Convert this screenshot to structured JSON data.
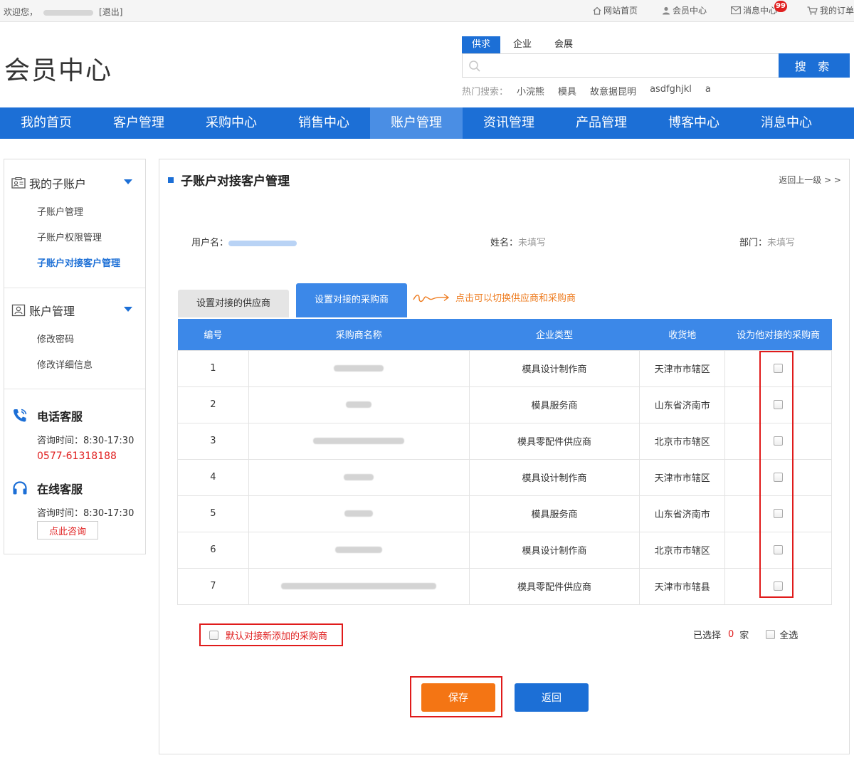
{
  "topbar": {
    "welcome": "欢迎您，",
    "logout": "[退出]",
    "links": [
      {
        "label": "网站首页",
        "icon": "home-icon"
      },
      {
        "label": "会员中心",
        "icon": "user-icon"
      },
      {
        "label": "消息中心",
        "icon": "mail-icon",
        "badge": "99"
      },
      {
        "label": "我的订单",
        "icon": "cart-icon"
      }
    ]
  },
  "header": {
    "logo": "会员中心",
    "search_tabs": [
      "供求",
      "企业",
      "会展"
    ],
    "search_button": "搜 索",
    "hot_label": "热门搜索：",
    "hot_keywords": [
      "小浣熊",
      "模具",
      "故意据昆明",
      "asdfghjkl",
      "a"
    ]
  },
  "nav": [
    "我的首页",
    "客户管理",
    "采购中心",
    "销售中心",
    "账户管理",
    "资讯管理",
    "产品管理",
    "博客中心",
    "消息中心"
  ],
  "sidebar": {
    "section1": {
      "title": "我的子账户",
      "items": [
        "子账户管理",
        "子账户权限管理",
        "子账户对接客户管理"
      ]
    },
    "section2": {
      "title": "账户管理",
      "items": [
        "修改密码",
        "修改详细信息"
      ]
    },
    "phone_service": {
      "title": "电话客服",
      "hours": "咨询时间：8:30-17:30",
      "phone": "0577-61318188"
    },
    "online_service": {
      "title": "在线客服",
      "hours": "咨询时间：8:30-17:30",
      "button": "点此咨询"
    }
  },
  "main": {
    "title": "子账户对接客户管理",
    "back": "返回上一级 > >",
    "info": {
      "username_label": "用户名：",
      "name_label": "姓名：",
      "name_value": "未填写",
      "dept_label": "部门：",
      "dept_value": "未填写"
    },
    "tabs": [
      "设置对接的供应商",
      "设置对接的采购商"
    ],
    "hint": "点击可以切换供应商和采购商",
    "columns": [
      "编号",
      "采购商名称",
      "企业类型",
      "收货地",
      "设为他对接的采购商"
    ],
    "rows": [
      {
        "no": "1",
        "type": "模具设计制作商",
        "place": "天津市市辖区"
      },
      {
        "no": "2",
        "type": "模具服务商",
        "place": "山东省济南市"
      },
      {
        "no": "3",
        "type": "模具零配件供应商",
        "place": "北京市市辖区"
      },
      {
        "no": "4",
        "type": "模具设计制作商",
        "place": "天津市市辖区"
      },
      {
        "no": "5",
        "type": "模具服务商",
        "place": "山东省济南市"
      },
      {
        "no": "6",
        "type": "模具设计制作商",
        "place": "北京市市辖区"
      },
      {
        "no": "7",
        "type": "模具零配件供应商",
        "place": "天津市市辖县"
      }
    ],
    "default_option": "默认对接新添加的采购商",
    "selected_prefix": "已选择",
    "selected_count": "0",
    "selected_suffix": "家",
    "select_all": "全选",
    "save": "保存",
    "return": "返回"
  }
}
